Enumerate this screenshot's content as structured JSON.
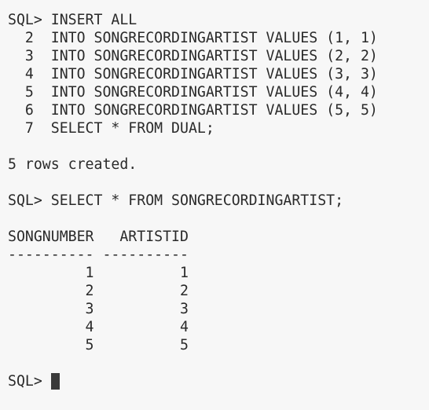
{
  "terminal": {
    "lines": [
      "SQL> INSERT ALL",
      "  2  INTO SONGRECORDINGARTIST VALUES (1, 1)",
      "  3  INTO SONGRECORDINGARTIST VALUES (2, 2)",
      "  4  INTO SONGRECORDINGARTIST VALUES (3, 3)",
      "  5  INTO SONGRECORDINGARTIST VALUES (4, 4)",
      "  6  INTO SONGRECORDINGARTIST VALUES (5, 5)",
      "  7  SELECT * FROM DUAL;",
      "",
      "5 rows created.",
      "",
      "SQL> SELECT * FROM SONGRECORDINGARTIST;",
      "",
      "SONGNUMBER   ARTISTID",
      "---------- ----------",
      "         1          1",
      "         2          2",
      "         3          3",
      "         4          4",
      "         5          5",
      "",
      "SQL> "
    ],
    "prompt": "SQL> "
  }
}
